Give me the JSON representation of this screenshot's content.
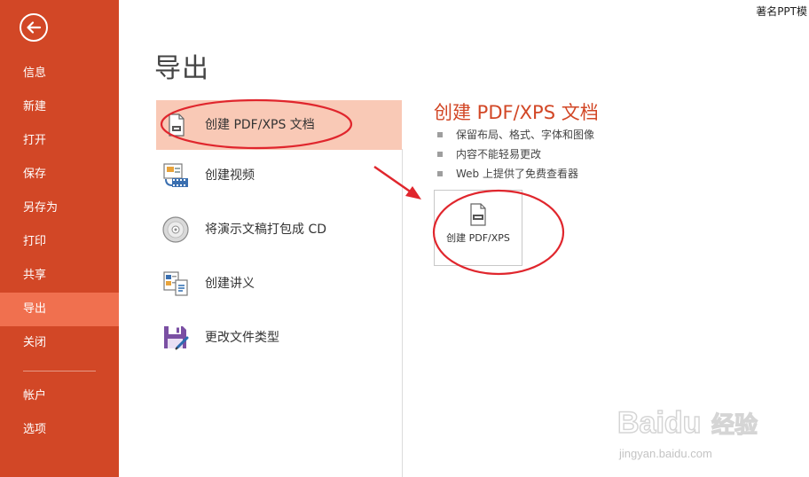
{
  "app": {
    "document_title": "著名PPT模"
  },
  "sidebar": {
    "items": [
      {
        "label": "信息"
      },
      {
        "label": "新建"
      },
      {
        "label": "打开"
      },
      {
        "label": "保存"
      },
      {
        "label": "另存为"
      },
      {
        "label": "打印"
      },
      {
        "label": "共享"
      },
      {
        "label": "导出"
      },
      {
        "label": "关闭"
      },
      {
        "label": "帐户"
      },
      {
        "label": "选项"
      }
    ],
    "active_item": "导出"
  },
  "page": {
    "title": "导出"
  },
  "export_options": [
    {
      "label": "创建 PDF/XPS 文档",
      "icon": "pdf-document-icon",
      "selected": true
    },
    {
      "label": "创建视频",
      "icon": "video-icon",
      "selected": false
    },
    {
      "label": "将演示文稿打包成 CD",
      "icon": "cd-icon",
      "selected": false
    },
    {
      "label": "创建讲义",
      "icon": "handout-icon",
      "selected": false
    },
    {
      "label": "更改文件类型",
      "icon": "save-as-type-icon",
      "selected": false
    }
  ],
  "detail": {
    "title": "创建 PDF/XPS 文档",
    "bullets": [
      "保留布局、格式、字体和图像",
      "内容不能轻易更改",
      "Web 上提供了免费查看器"
    ],
    "button_label": "创建 PDF/XPS"
  },
  "watermark": {
    "brand": "Baidu",
    "product": "经验",
    "url": "jingyan.baidu.com"
  },
  "colors": {
    "sidebar": "#d24726",
    "sidebar_active": "#f0704f",
    "selected_option": "#f9c9b6",
    "accent_title": "#d24726",
    "annotation_red": "#e0262d"
  }
}
